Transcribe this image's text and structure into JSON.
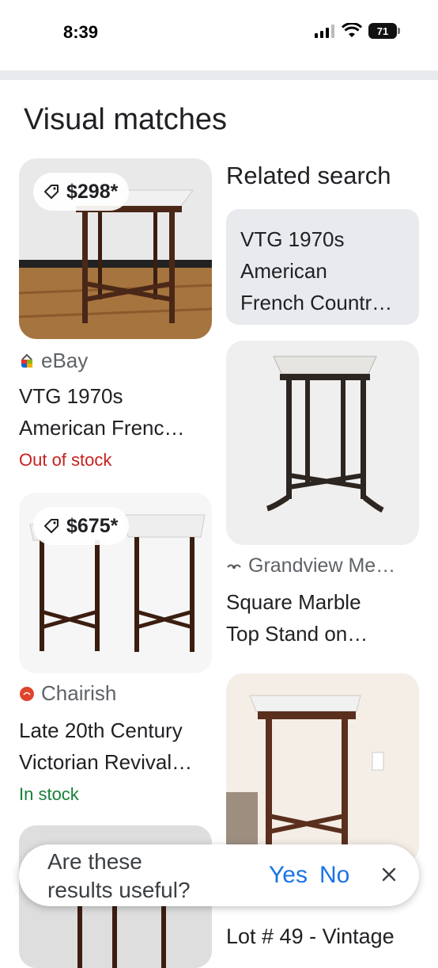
{
  "status": {
    "time": "8:39",
    "battery": "71"
  },
  "section_title": "Visual matches",
  "left_column": [
    {
      "price": "$298*",
      "source": "eBay",
      "title": "VTG 1970s\nAmerican Frenc…",
      "stock": "Out of stock",
      "stock_color": "#c5221f"
    },
    {
      "price": "$675*",
      "source": "Chairish",
      "title": "Late 20th Century\nVictorian Revival…",
      "stock": "In stock",
      "stock_color": "#188038"
    }
  ],
  "right_column": {
    "related_title": "Related search",
    "related_query": "VTG 1970s\nAmerican\nFrench Countr…",
    "items": [
      {
        "source": "Grandview Me…",
        "title": "Square Marble\nTop Stand on…"
      },
      {
        "title_partial": "Lot # 49 - Vintage"
      }
    ]
  },
  "feedback": {
    "question": "Are these\nresults useful?",
    "yes": "Yes",
    "no": "No"
  },
  "icons": {
    "tag": "tag-icon",
    "close": "close-icon",
    "ebay": "ebay-logo-icon",
    "chairish": "chairish-logo-icon",
    "grandview": "grandview-logo-icon"
  }
}
